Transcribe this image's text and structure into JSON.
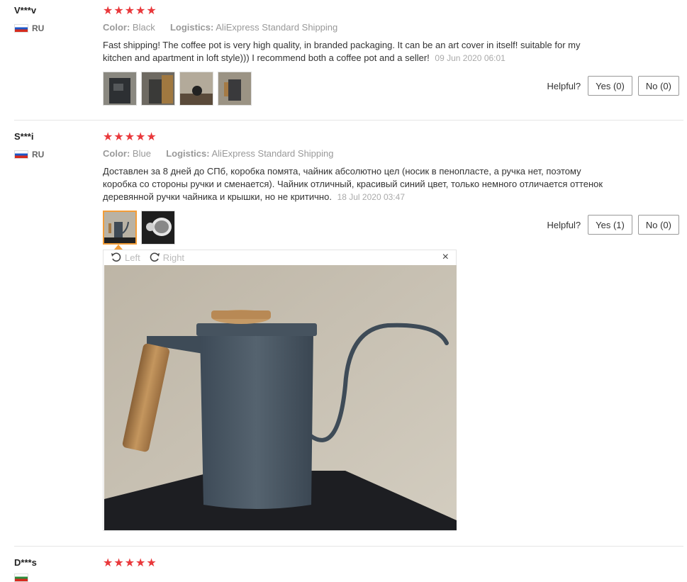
{
  "reviews": [
    {
      "user": "V***v",
      "country": "RU",
      "stars": "★★★★★",
      "color_label": "Color:",
      "color_value": "Black",
      "logistics_label": "Logistics:",
      "logistics_value": "AliExpress Standard Shipping",
      "text": "Fast shipping! The coffee pot is very high quality, in branded packaging. It can be an art cover in itself! suitable for my kitchen and apartment in loft style))) I recommend both a coffee pot and a seller!",
      "date": "09 Jun 2020 06:01",
      "helpful_label": "Helpful?",
      "yes_label": "Yes (0)",
      "no_label": "No (0)"
    },
    {
      "user": "S***i",
      "country": "RU",
      "stars": "★★★★★",
      "color_label": "Color:",
      "color_value": "Blue",
      "logistics_label": "Logistics:",
      "logistics_value": "AliExpress Standard Shipping",
      "text": "Доставлен за 8 дней до СПб, коробка помята, чайник абсолютно цел (носик в пенопласте, а ручка нет, поэтому коробка со стороны ручки и сменается). Чайник отличный, красивый синий цвет, только немного отличается оттенок деревянной ручки чайника и крышки, но не критично.",
      "date": "18 Jul 2020 03:47",
      "helpful_label": "Helpful?",
      "yes_label": "Yes (1)",
      "no_label": "No (0)"
    },
    {
      "user": "D***s",
      "stars": "★★★★★"
    }
  ],
  "viewer": {
    "left_label": "Left",
    "right_label": "Right",
    "close": "×"
  },
  "colors": {
    "star": "#e9383b",
    "selected_thumb": "#f29d38"
  }
}
